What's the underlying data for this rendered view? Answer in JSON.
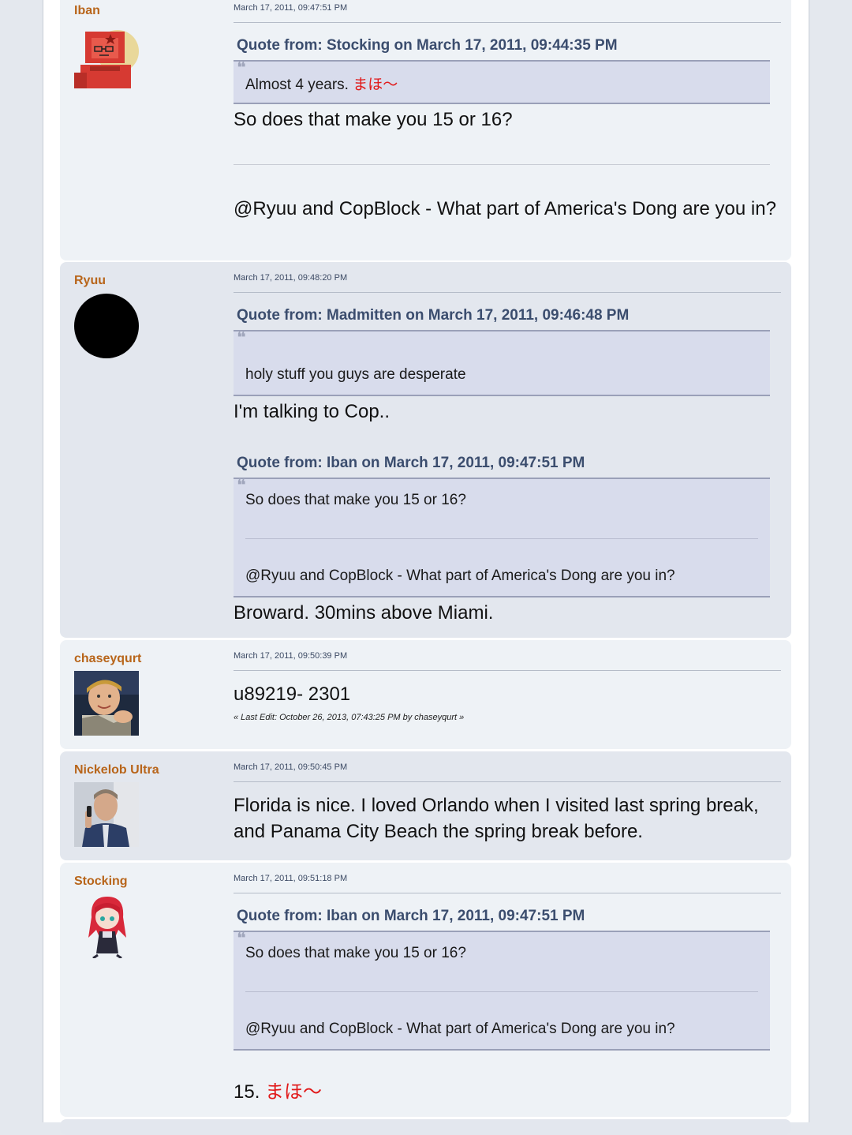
{
  "posts": [
    {
      "poster": "Iban",
      "time": "March 17, 2011, 09:47:51 PM",
      "quote_header": "Quote from: Stocking on March 17, 2011, 09:44:35 PM",
      "quote_text": "Almost 4 years.",
      "quote_jp": "まほ〜",
      "body_1": "So does that make you 15 or 16?",
      "body_2": "@Ryuu and CopBlock - What part of America's Dong are you in?"
    },
    {
      "poster": "Ryuu",
      "time": "March 17, 2011, 09:48:20 PM",
      "quote1_header": "Quote from: Madmitten on March 17, 2011, 09:46:48 PM",
      "quote1_text": "holy stuff you guys are desperate",
      "reply_1": "I'm talking to Cop..",
      "quote2_header": "Quote from: Iban on March 17, 2011, 09:47:51 PM",
      "quote2_text_1": "So does that make you 15 or 16?",
      "quote2_text_2": "@Ryuu and CopBlock - What part of America's Dong are you in?",
      "reply_2": "Broward. 30mins above Miami."
    },
    {
      "poster": "chaseyqurt",
      "time": "March 17, 2011, 09:50:39 PM",
      "body": "u89219- 2301",
      "last_edit": "« Last Edit: October 26, 2013, 07:43:25 PM by chaseyqurt »"
    },
    {
      "poster": "Nickelob Ultra",
      "time": "March 17, 2011, 09:50:45 PM",
      "body": "Florida is nice.  I loved Orlando when I visited last spring break, and Panama City Beach the spring break before."
    },
    {
      "poster": "Stocking",
      "time": "March 17, 2011, 09:51:18 PM",
      "quote_header": "Quote from: Iban on March 17, 2011, 09:47:51 PM",
      "quote_text_1": "So does that make you 15 or 16?",
      "quote_text_2": "@Ryuu and CopBlock - What part of America's Dong are you in?",
      "body": "15.",
      "body_jp": "まほ〜"
    }
  ],
  "colors": {
    "poster_name": "#b8651a",
    "quote_header": "#3b4d6e",
    "quote_bg": "#d8dcec",
    "jp_accent": "#e11b1b"
  }
}
